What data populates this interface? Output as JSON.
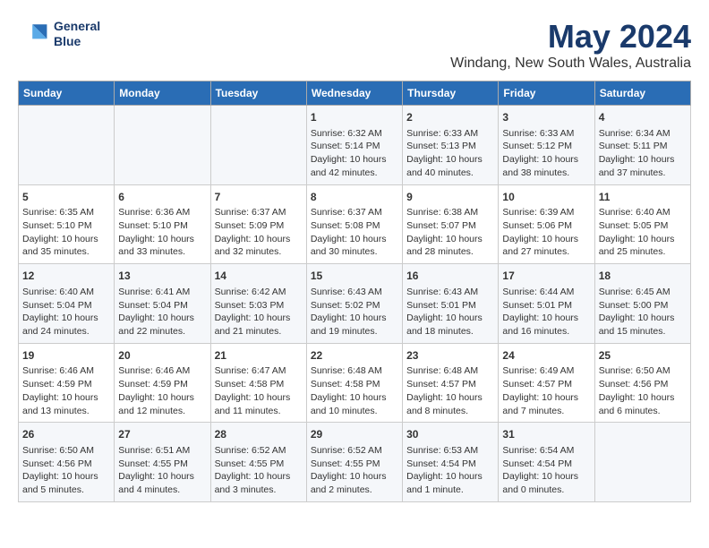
{
  "header": {
    "logo_line1": "General",
    "logo_line2": "Blue",
    "title": "May 2024",
    "subtitle": "Windang, New South Wales, Australia"
  },
  "days_of_week": [
    "Sunday",
    "Monday",
    "Tuesday",
    "Wednesday",
    "Thursday",
    "Friday",
    "Saturday"
  ],
  "weeks": [
    {
      "cells": [
        {
          "day": "",
          "info": ""
        },
        {
          "day": "",
          "info": ""
        },
        {
          "day": "",
          "info": ""
        },
        {
          "day": "1",
          "info": "Sunrise: 6:32 AM\nSunset: 5:14 PM\nDaylight: 10 hours\nand 42 minutes."
        },
        {
          "day": "2",
          "info": "Sunrise: 6:33 AM\nSunset: 5:13 PM\nDaylight: 10 hours\nand 40 minutes."
        },
        {
          "day": "3",
          "info": "Sunrise: 6:33 AM\nSunset: 5:12 PM\nDaylight: 10 hours\nand 38 minutes."
        },
        {
          "day": "4",
          "info": "Sunrise: 6:34 AM\nSunset: 5:11 PM\nDaylight: 10 hours\nand 37 minutes."
        }
      ]
    },
    {
      "cells": [
        {
          "day": "5",
          "info": "Sunrise: 6:35 AM\nSunset: 5:10 PM\nDaylight: 10 hours\nand 35 minutes."
        },
        {
          "day": "6",
          "info": "Sunrise: 6:36 AM\nSunset: 5:10 PM\nDaylight: 10 hours\nand 33 minutes."
        },
        {
          "day": "7",
          "info": "Sunrise: 6:37 AM\nSunset: 5:09 PM\nDaylight: 10 hours\nand 32 minutes."
        },
        {
          "day": "8",
          "info": "Sunrise: 6:37 AM\nSunset: 5:08 PM\nDaylight: 10 hours\nand 30 minutes."
        },
        {
          "day": "9",
          "info": "Sunrise: 6:38 AM\nSunset: 5:07 PM\nDaylight: 10 hours\nand 28 minutes."
        },
        {
          "day": "10",
          "info": "Sunrise: 6:39 AM\nSunset: 5:06 PM\nDaylight: 10 hours\nand 27 minutes."
        },
        {
          "day": "11",
          "info": "Sunrise: 6:40 AM\nSunset: 5:05 PM\nDaylight: 10 hours\nand 25 minutes."
        }
      ]
    },
    {
      "cells": [
        {
          "day": "12",
          "info": "Sunrise: 6:40 AM\nSunset: 5:04 PM\nDaylight: 10 hours\nand 24 minutes."
        },
        {
          "day": "13",
          "info": "Sunrise: 6:41 AM\nSunset: 5:04 PM\nDaylight: 10 hours\nand 22 minutes."
        },
        {
          "day": "14",
          "info": "Sunrise: 6:42 AM\nSunset: 5:03 PM\nDaylight: 10 hours\nand 21 minutes."
        },
        {
          "day": "15",
          "info": "Sunrise: 6:43 AM\nSunset: 5:02 PM\nDaylight: 10 hours\nand 19 minutes."
        },
        {
          "day": "16",
          "info": "Sunrise: 6:43 AM\nSunset: 5:01 PM\nDaylight: 10 hours\nand 18 minutes."
        },
        {
          "day": "17",
          "info": "Sunrise: 6:44 AM\nSunset: 5:01 PM\nDaylight: 10 hours\nand 16 minutes."
        },
        {
          "day": "18",
          "info": "Sunrise: 6:45 AM\nSunset: 5:00 PM\nDaylight: 10 hours\nand 15 minutes."
        }
      ]
    },
    {
      "cells": [
        {
          "day": "19",
          "info": "Sunrise: 6:46 AM\nSunset: 4:59 PM\nDaylight: 10 hours\nand 13 minutes."
        },
        {
          "day": "20",
          "info": "Sunrise: 6:46 AM\nSunset: 4:59 PM\nDaylight: 10 hours\nand 12 minutes."
        },
        {
          "day": "21",
          "info": "Sunrise: 6:47 AM\nSunset: 4:58 PM\nDaylight: 10 hours\nand 11 minutes."
        },
        {
          "day": "22",
          "info": "Sunrise: 6:48 AM\nSunset: 4:58 PM\nDaylight: 10 hours\nand 10 minutes."
        },
        {
          "day": "23",
          "info": "Sunrise: 6:48 AM\nSunset: 4:57 PM\nDaylight: 10 hours\nand 8 minutes."
        },
        {
          "day": "24",
          "info": "Sunrise: 6:49 AM\nSunset: 4:57 PM\nDaylight: 10 hours\nand 7 minutes."
        },
        {
          "day": "25",
          "info": "Sunrise: 6:50 AM\nSunset: 4:56 PM\nDaylight: 10 hours\nand 6 minutes."
        }
      ]
    },
    {
      "cells": [
        {
          "day": "26",
          "info": "Sunrise: 6:50 AM\nSunset: 4:56 PM\nDaylight: 10 hours\nand 5 minutes."
        },
        {
          "day": "27",
          "info": "Sunrise: 6:51 AM\nSunset: 4:55 PM\nDaylight: 10 hours\nand 4 minutes."
        },
        {
          "day": "28",
          "info": "Sunrise: 6:52 AM\nSunset: 4:55 PM\nDaylight: 10 hours\nand 3 minutes."
        },
        {
          "day": "29",
          "info": "Sunrise: 6:52 AM\nSunset: 4:55 PM\nDaylight: 10 hours\nand 2 minutes."
        },
        {
          "day": "30",
          "info": "Sunrise: 6:53 AM\nSunset: 4:54 PM\nDaylight: 10 hours\nand 1 minute."
        },
        {
          "day": "31",
          "info": "Sunrise: 6:54 AM\nSunset: 4:54 PM\nDaylight: 10 hours\nand 0 minutes."
        },
        {
          "day": "",
          "info": ""
        }
      ]
    }
  ]
}
